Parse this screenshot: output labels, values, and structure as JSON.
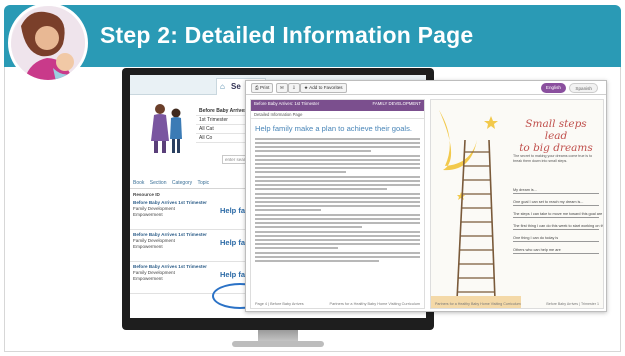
{
  "slide": {
    "title": "Step 2: Detailed Information Page",
    "header_color": "#2a9ab5"
  },
  "website": {
    "tab_label": "Se",
    "filter_options": [
      "Before Baby Arrives",
      "1st Trimester",
      "All Cat",
      "All Co"
    ],
    "search_placeholder": "enter search t",
    "column_headers": [
      "Book",
      "Section",
      "Category",
      "Topic"
    ],
    "results_heading": "Resource ID",
    "results": [
      {
        "title": "Before Baby Arrives 1st Trimester",
        "category": "Family Development",
        "subcat": "Empowerment",
        "link": "Help fa"
      },
      {
        "title": "Before Baby Arrives 1st Trimester",
        "category": "Family Development",
        "subcat": "Empowerment",
        "link": "Help fa"
      },
      {
        "title": "Before Baby Arrives 1st Trimester",
        "category": "Family Development",
        "subcat": "Empowerment",
        "link": "Help fa"
      }
    ]
  },
  "document": {
    "toolbar": {
      "print_label": "Print",
      "favorites_label": "Add to Favorites",
      "english_label": "English",
      "spanish_label": "Spanish"
    },
    "left_page": {
      "header_left": "Before Baby Arrives: 1st Trimester",
      "header_right": "FAMILY DEVELOPMENT",
      "subheader": "Detailed Information Page",
      "title": "Help family make a plan to achieve their goals.",
      "footer_left": "Page 4 | Before Baby Arrives",
      "footer_right": "Partners for a Healthy Baby Home Visiting Curriculum"
    },
    "right_page": {
      "poster_title_line1": "Small steps lead",
      "poster_title_line2": "to big dreams",
      "poster_intro": "The secret to making your dreams come true is to break them down into small steps.",
      "prompts": [
        "My dream is...",
        "One goal I can set to reach my dream is...",
        "The steps I can take to move me toward this goal are",
        "The first thing I can do this week to start working on this goal is",
        "One thing I can do today is",
        "Others who can help me are"
      ],
      "footer_left": "Partners for a Healthy Baby Home Visiting Curriculum",
      "footer_right": "Before Baby Arrives | Trimester 1"
    }
  },
  "colors": {
    "highlight_oval": "#2b72c6",
    "doc_header": "#7b4f8e",
    "doc_title": "#4a86b8",
    "poster_title": "#c0504d"
  }
}
